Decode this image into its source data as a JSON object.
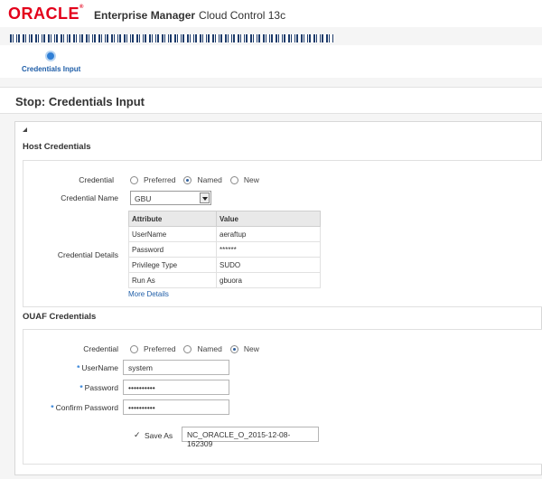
{
  "header": {
    "logo_text": "ORACLE",
    "logo_mark": "®",
    "app_name": "Enterprise Manager",
    "app_sub": "Cloud Control 13c"
  },
  "train": {
    "step_label": "Credentials Input"
  },
  "page_title": "Stop: Credentials Input",
  "host": {
    "title": "Host Credentials",
    "credential_label": "Credential",
    "options": [
      "Preferred",
      "Named",
      "New"
    ],
    "selected": "Named",
    "credential_name_label": "Credential Name",
    "credential_name_value": "GBU",
    "details_label": "Credential Details",
    "table_headers": [
      "Attribute",
      "Value"
    ],
    "rows": [
      [
        "UserName",
        "aeraftup"
      ],
      [
        "Password",
        "******"
      ],
      [
        "Privilege Type",
        "SUDO"
      ],
      [
        "Run As",
        "gbuora"
      ]
    ],
    "more_details": "More Details"
  },
  "ouaf": {
    "title": "OUAF Credentials",
    "credential_label": "Credential",
    "options": [
      "Preferred",
      "Named",
      "New"
    ],
    "selected": "New",
    "username_label": "UserName",
    "username_value": "system",
    "password_label": "Password",
    "password_value": "••••••••••",
    "confirm_label": "Confirm Password",
    "confirm_value": "••••••••••",
    "save_check": "✓",
    "save_as_label": "Save As",
    "save_as_value": "NC_ORACLE_O_2015-12-08-162309"
  }
}
